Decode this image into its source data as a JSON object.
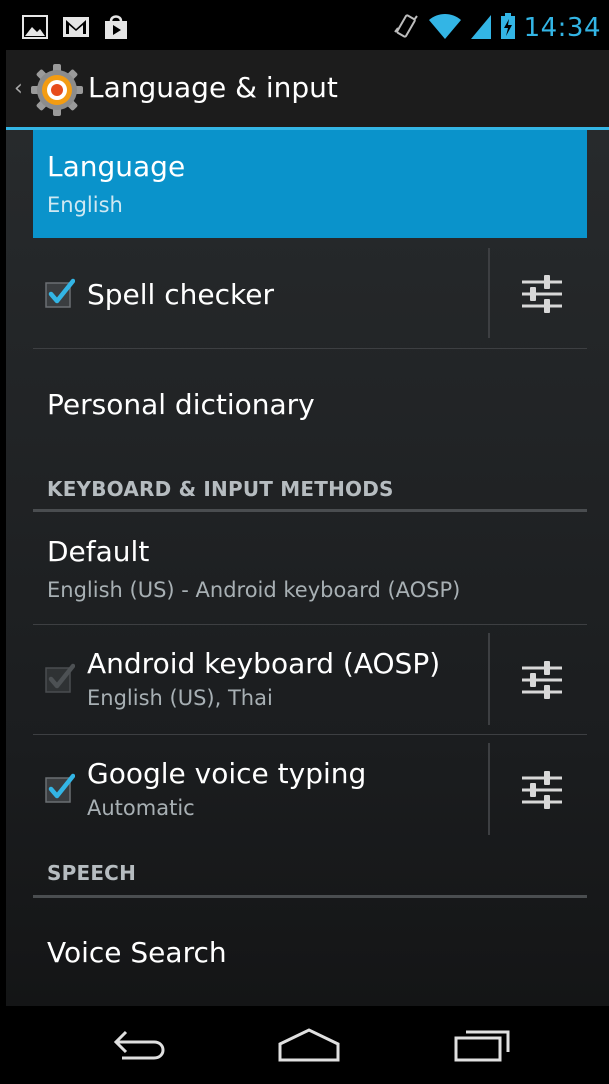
{
  "status_bar": {
    "time": "14:34",
    "left_icons": [
      "picture-icon",
      "gmail-icon",
      "store-bag-icon"
    ],
    "right_icons": [
      "vibrate-icon",
      "wifi-icon",
      "signal-icon",
      "battery-charging-icon"
    ]
  },
  "action_bar": {
    "title": "Language & input",
    "icon": "settings-gear-icon"
  },
  "items": {
    "language": {
      "title": "Language",
      "summary": "English"
    },
    "spell_checker": {
      "title": "Spell checker",
      "checked": true
    },
    "personal_dictionary": {
      "title": "Personal dictionary"
    },
    "keyboard_header": "KEYBOARD & INPUT METHODS",
    "default": {
      "title": "Default",
      "summary": "English (US) - Android keyboard (AOSP)"
    },
    "android_keyboard": {
      "title": "Android keyboard (AOSP)",
      "summary": "English (US), Thai",
      "checked": true,
      "enabled": false
    },
    "google_voice": {
      "title": "Google voice typing",
      "summary": "Automatic",
      "checked": true
    },
    "speech_header": "SPEECH",
    "voice_search": {
      "title": "Voice Search"
    }
  },
  "navigation": [
    "back-icon",
    "home-icon",
    "recents-icon"
  ],
  "colors": {
    "accent": "#33b5e5",
    "selected_background": "#0a93cb"
  }
}
